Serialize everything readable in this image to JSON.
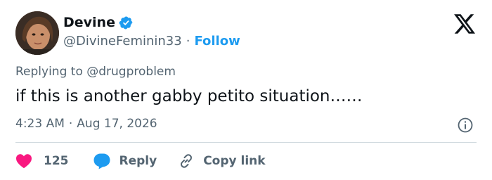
{
  "author": {
    "name": "Devine",
    "handle": "@DivineFeminin33",
    "separator": "·",
    "follow_label": "Follow",
    "avatar_icon": "profile-photo",
    "verified_color": "#1d9bf0"
  },
  "tweet": {
    "reply_prefix": "Replying to",
    "reply_to": "@drugproblem",
    "text": "if this is another gabby petito situation……",
    "time": "4:23 AM",
    "date": "Aug 17, 2026",
    "separator": "·"
  },
  "actions": {
    "likes": "125",
    "reply_label": "Reply",
    "copy_label": "Copy link"
  },
  "colors": {
    "like": "#f91880",
    "reply": "#1d9bf0",
    "link": "#1d9bf0",
    "muted": "#536471",
    "text": "#0f1419"
  },
  "icons": [
    "x-logo-icon",
    "verified-badge-icon",
    "info-icon",
    "heart-icon",
    "reply-bubble-icon",
    "link-icon"
  ]
}
